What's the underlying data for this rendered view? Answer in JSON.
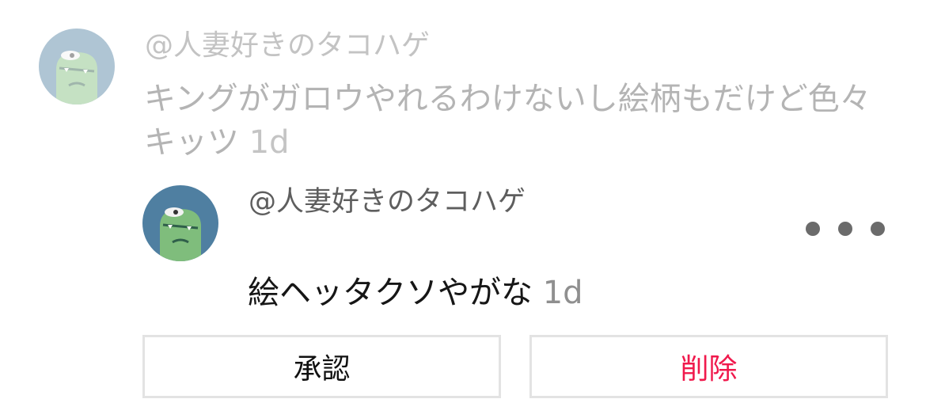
{
  "parent_comment": {
    "username": "@人妻好きのタコハゲ",
    "text": "キングがガロウやれるわけないし絵柄もだけど色々キッツ",
    "time": "1d"
  },
  "reply": {
    "username": "@人妻好きのタコハゲ",
    "text": "絵ヘッタクソやがな",
    "time": "1d"
  },
  "actions": {
    "approve_label": "承認",
    "delete_label": "削除"
  },
  "colors": {
    "delete_accent": "#f0194c",
    "avatar_bg": "#4f7fa1",
    "avatar_face": "#7fbd7c"
  },
  "icons": {
    "avatar": "green-monster-avatar-icon",
    "more": "more-options-icon"
  }
}
